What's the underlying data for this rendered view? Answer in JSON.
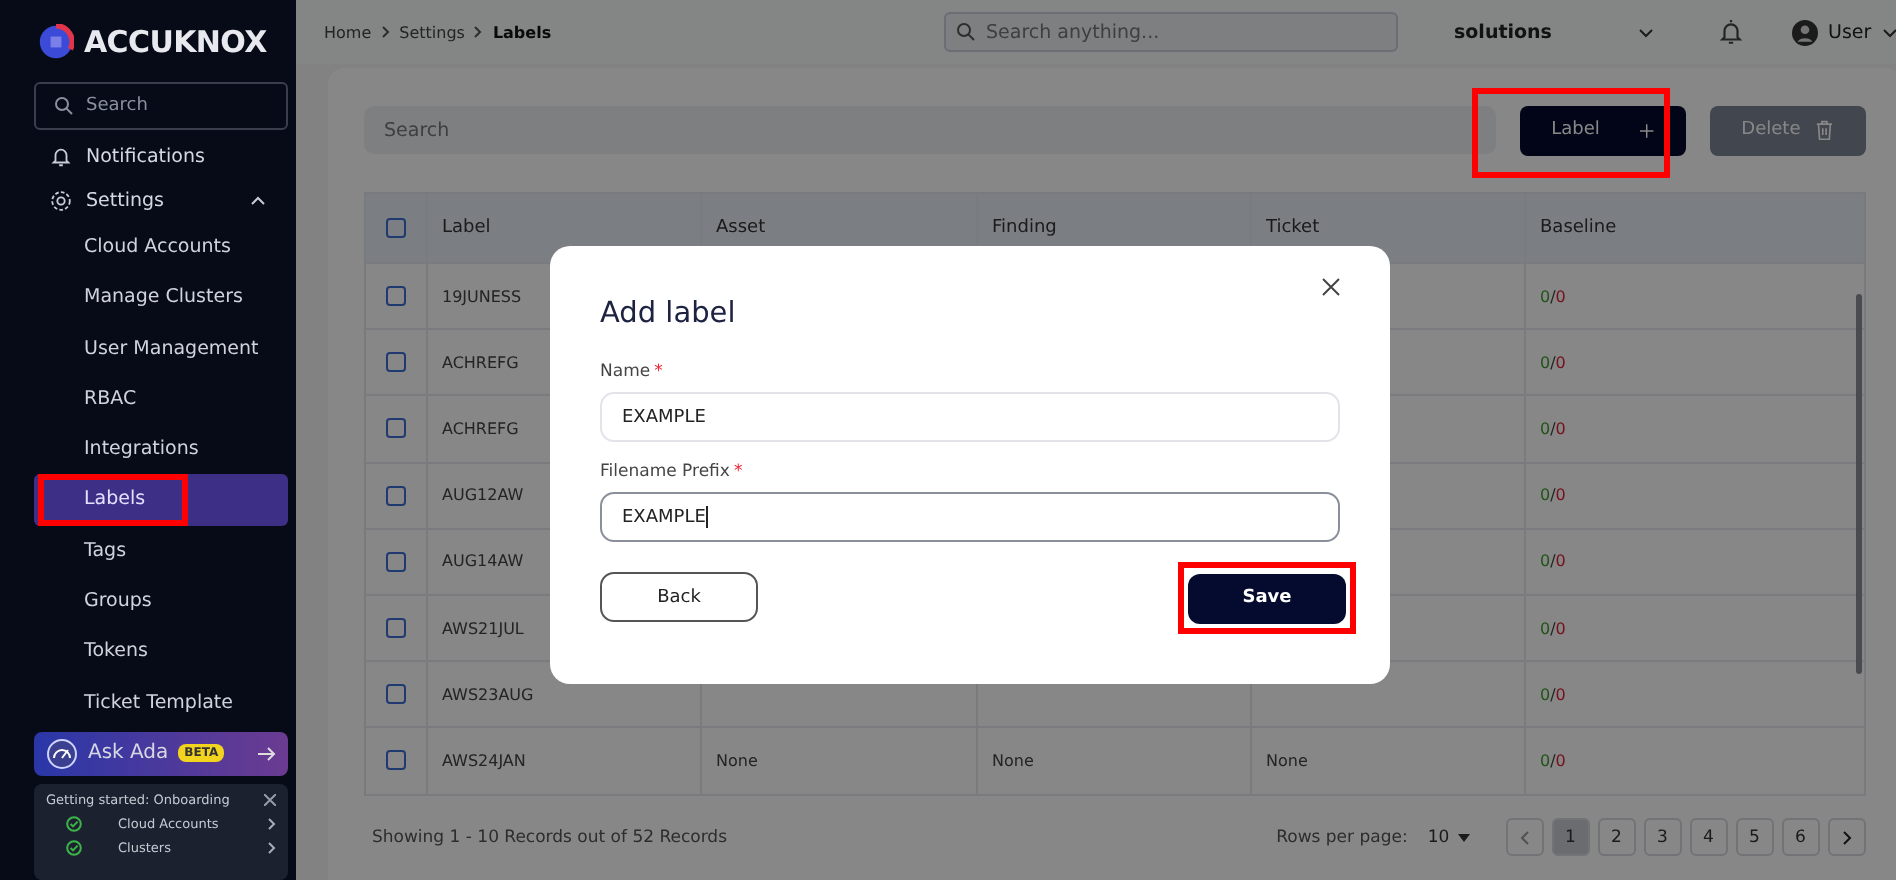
{
  "sidebar": {
    "logo": "ACCUKNOX",
    "search": {
      "placeholder": "Search"
    },
    "notifications": {
      "label": "Notifications"
    },
    "settings": {
      "label": "Settings",
      "expanded": true,
      "children": [
        {
          "label": "Cloud Accounts",
          "selected": false
        },
        {
          "label": "Manage Clusters",
          "selected": false
        },
        {
          "label": "User Management",
          "selected": false
        },
        {
          "label": "RBAC",
          "selected": false
        },
        {
          "label": "Integrations",
          "selected": false
        },
        {
          "label": "Labels",
          "selected": true
        },
        {
          "label": "Tags",
          "selected": false
        },
        {
          "label": "Groups",
          "selected": false
        },
        {
          "label": "Tokens",
          "selected": false
        },
        {
          "label": "Ticket Template",
          "selected": false
        }
      ]
    },
    "ask_ada": {
      "label": "Ask Ada",
      "badge": "BETA"
    },
    "onboarding": {
      "title": "Getting started: Onboarding",
      "steps": [
        {
          "label": "Cloud Accounts",
          "done": true
        },
        {
          "label": "Clusters",
          "done": true
        }
      ]
    }
  },
  "topbar": {
    "breadcrumb": [
      "Home",
      "Settings",
      "Labels"
    ],
    "search": {
      "placeholder": "Search anything..."
    },
    "workspace": "solutions",
    "user": "User"
  },
  "toolbar": {
    "search": {
      "placeholder": "Search"
    },
    "buttons": [
      {
        "label": "Label",
        "kind": "add",
        "disabled": false
      },
      {
        "label": "Delete",
        "kind": "delete",
        "disabled": true
      }
    ]
  },
  "table": {
    "columns": [
      "Label",
      "Asset",
      "Finding",
      "Ticket",
      "Baseline"
    ],
    "all_checked": false,
    "rows": [
      {
        "label": "19JUNESS",
        "checked": false,
        "baseline": [
          "0",
          "/",
          "0"
        ]
      },
      {
        "label": "ACHREFG",
        "checked": false,
        "baseline": [
          "0",
          "/",
          "0"
        ]
      },
      {
        "label": "ACHREFG",
        "checked": false,
        "baseline": [
          "0",
          "/",
          "0"
        ]
      },
      {
        "label": "AUG12AW",
        "checked": false,
        "baseline": [
          "0",
          "/",
          "0"
        ]
      },
      {
        "label": "AUG14AW",
        "checked": false,
        "baseline": [
          "0",
          "/",
          "0"
        ]
      },
      {
        "label": "AWS21JUL",
        "checked": false,
        "baseline": [
          "0",
          "/",
          "0"
        ]
      },
      {
        "label": "AWS23AUG",
        "checked": false,
        "baseline": [
          "0",
          "/",
          "0"
        ]
      },
      {
        "label": "AWS24JAN",
        "checked": false,
        "asset": "None",
        "finding": "None",
        "ticket": "None",
        "baseline": [
          "0",
          "/",
          "0"
        ]
      }
    ]
  },
  "footer": {
    "summary": "Showing 1 - 10 Records out of 52 Records",
    "rows_per_page": "Rows per page:",
    "page_size": "10",
    "pages": [
      {
        "label": "1",
        "selected": true
      },
      {
        "label": "2",
        "selected": false
      },
      {
        "label": "3",
        "selected": false
      },
      {
        "label": "4",
        "selected": false
      },
      {
        "label": "5",
        "selected": false
      },
      {
        "label": "6",
        "selected": false
      }
    ]
  },
  "dialog": {
    "title": "Add label",
    "required_mark": "*",
    "fields": [
      {
        "label": "Name",
        "value": "EXAMPLE",
        "focused": false
      },
      {
        "label": "Filename Prefix",
        "value": "EXAMPLE",
        "focused": true
      }
    ],
    "back": "Back",
    "save": "Save"
  }
}
